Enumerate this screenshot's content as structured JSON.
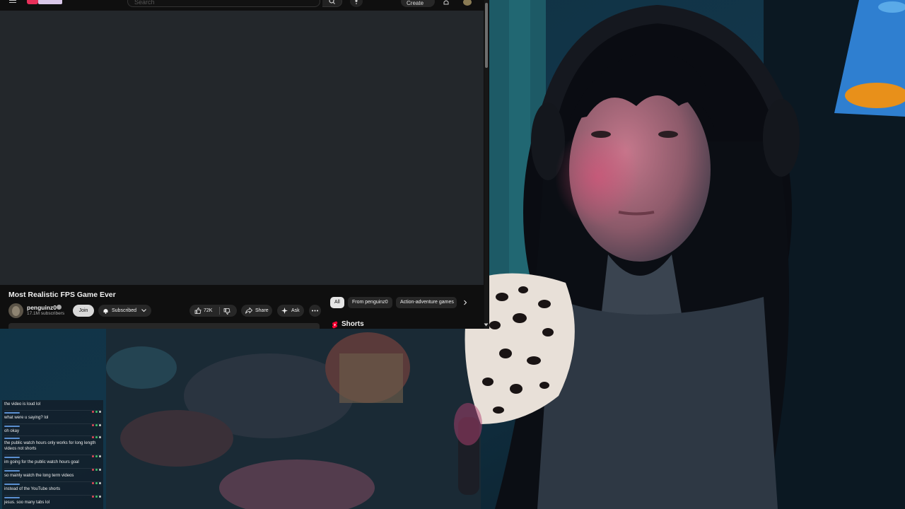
{
  "youtube": {
    "search_placeholder": "Search",
    "create_label": "Create",
    "video_title": "Most Realistic FPS Game Ever",
    "channel_name": "penguinz0",
    "subscribers": "17.1M subscribers",
    "join_label": "Join",
    "subscribed_label": "Subscribed",
    "like_count": "72K",
    "share_label": "Share",
    "ask_label": "Ask",
    "chips": [
      "All",
      "From penguinz0",
      "Action-adventure games"
    ],
    "shorts_label": "Shorts",
    "colors": {
      "background": "#0f0f0f",
      "player": "#23272b",
      "chip_active": "#e5e5e5",
      "shorts_red": "#ff0033"
    }
  },
  "chat": {
    "messages": [
      {
        "text": "the video is loud lol"
      },
      {
        "text": "what were u saying? lol"
      },
      {
        "text": "oh okay"
      },
      {
        "text": "the public watch hours only works for long length videos not shorts"
      },
      {
        "text": "im going for the public watch hours goal"
      },
      {
        "text": "so mainly watch the long term videos"
      },
      {
        "text": "instead of the YouTube shorts"
      },
      {
        "text": "jesus. soo many tabs lol"
      }
    ],
    "badge_colors": [
      "#e04a5a",
      "#3fc16a",
      "#c8c8c8"
    ]
  }
}
